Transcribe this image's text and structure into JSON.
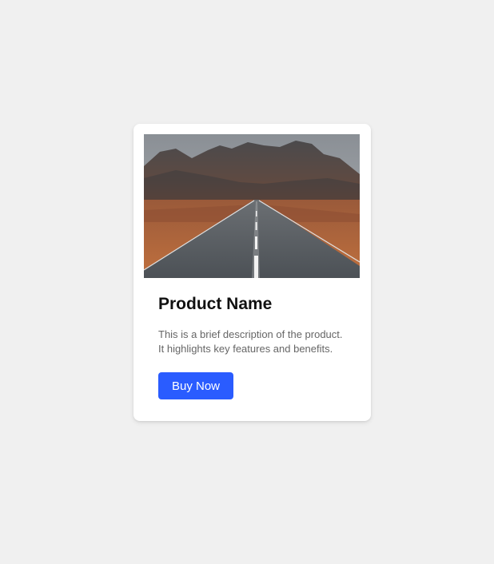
{
  "product": {
    "name": "Product Name",
    "description_lines": [
      "This is a brief description of the product.",
      "It highlights key features and benefits."
    ],
    "buy_label": "Buy Now"
  },
  "colors": {
    "page_background": "#f0f0f0",
    "card_background": "#ffffff",
    "accent": "#2a5cff",
    "title_text": "#111111",
    "description_text": "#666666"
  }
}
